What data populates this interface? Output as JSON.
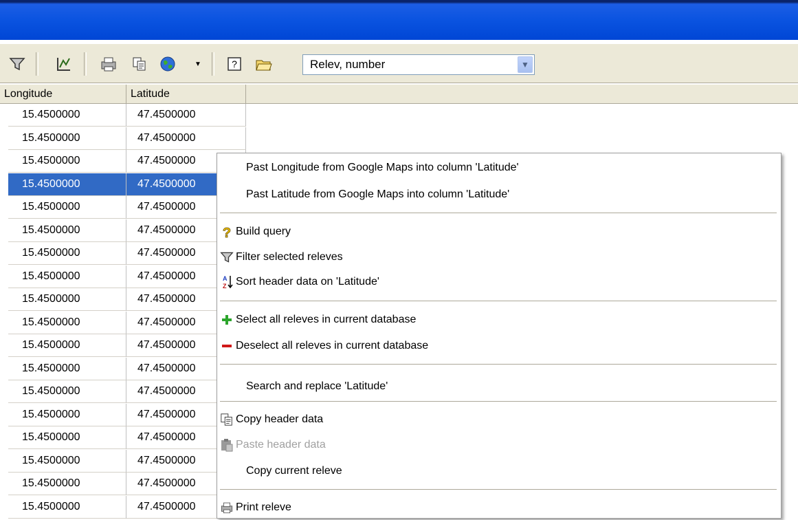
{
  "toolbar": {
    "combo_value": "Relev, number"
  },
  "grid": {
    "columns": [
      "Longitude",
      "Latitude"
    ],
    "rows": [
      [
        "15.4500000",
        "47.4500000"
      ],
      [
        "15.4500000",
        "47.4500000"
      ],
      [
        "15.4500000",
        "47.4500000"
      ],
      [
        "15.4500000",
        "47.4500000"
      ],
      [
        "15.4500000",
        "47.4500000"
      ],
      [
        "15.4500000",
        "47.4500000"
      ],
      [
        "15.4500000",
        "47.4500000"
      ],
      [
        "15.4500000",
        "47.4500000"
      ],
      [
        "15.4500000",
        "47.4500000"
      ],
      [
        "15.4500000",
        "47.4500000"
      ],
      [
        "15.4500000",
        "47.4500000"
      ],
      [
        "15.4500000",
        "47.4500000"
      ],
      [
        "15.4500000",
        "47.4500000"
      ],
      [
        "15.4500000",
        "47.4500000"
      ],
      [
        "15.4500000",
        "47.4500000"
      ],
      [
        "15.4500000",
        "47.4500000"
      ],
      [
        "15.4500000",
        "47.4500000"
      ],
      [
        "15.4500000",
        "47.4500000"
      ]
    ],
    "selected_row": 3
  },
  "menu": {
    "items": [
      "Past Longitude from Google Maps into column 'Latitude'",
      "Past Latitude from Google Maps into column 'Latitude'",
      "Build query",
      "Filter selected releves",
      "Sort header data on 'Latitude'",
      "Select all releves in current database",
      "Deselect all releves in current database",
      "Search and replace 'Latitude'",
      "Copy header data",
      "Paste header data",
      "Copy current releve",
      "Print releve"
    ]
  },
  "colors": {
    "titlebar": "#0a53e0",
    "selection": "#316ac5",
    "toolbar_bg": "#ece9d8"
  }
}
